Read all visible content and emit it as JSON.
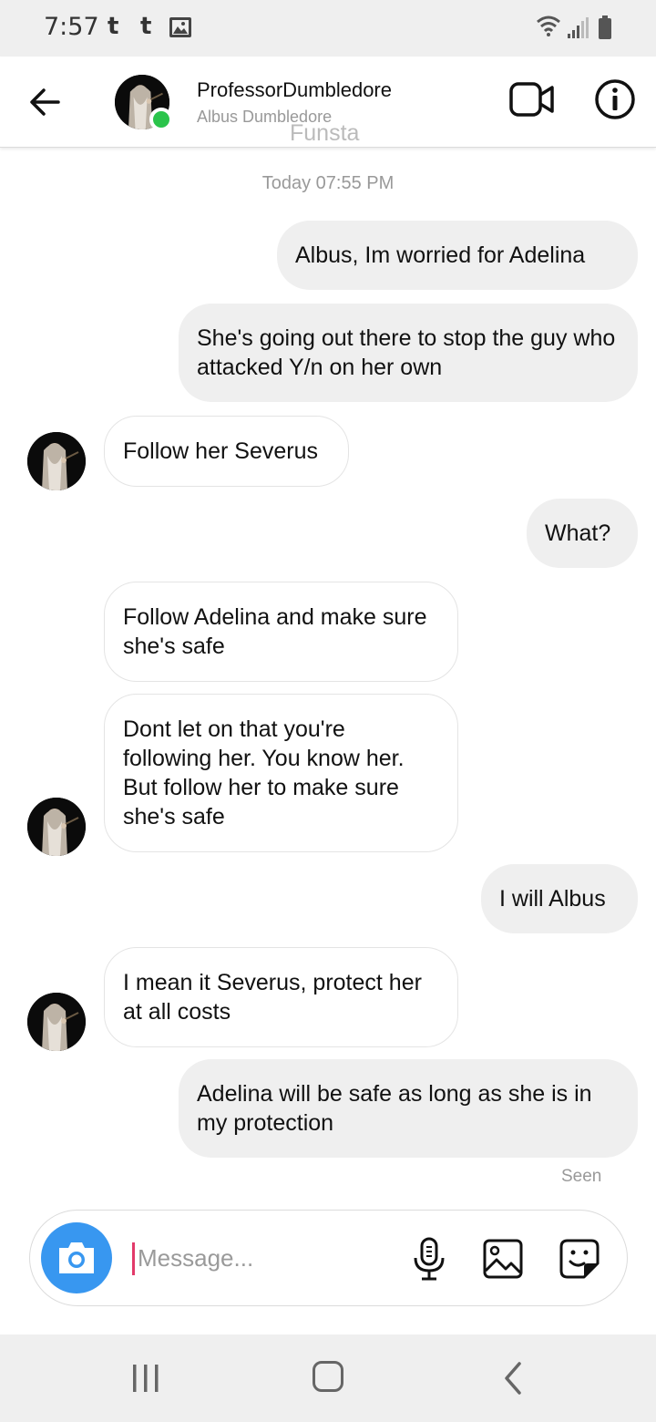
{
  "status_bar": {
    "time": "7:57",
    "notif_1": "t",
    "notif_2": "t",
    "image_icon": "gallery-notification-icon",
    "wifi_icon": "wifi-icon",
    "signal_icon": "cellular-signal-icon",
    "battery_icon": "battery-icon"
  },
  "header": {
    "back_icon": "arrow-left-icon",
    "username": "ProfessorDumbledore",
    "display_name": "Albus Dumbledore",
    "watermark": "Funsta",
    "video_icon": "video-call-icon",
    "info_icon": "info-icon",
    "online_color": "#2bc44b"
  },
  "conversation": {
    "timestamp": "Today 07:55 PM",
    "messages": [
      {
        "direction": "outgoing",
        "text": "Albus, Im worried for Adelina"
      },
      {
        "direction": "outgoing",
        "text": "She's going out there to stop the guy who attacked Y/n on her own"
      },
      {
        "direction": "incoming",
        "text": "Follow her Severus"
      },
      {
        "direction": "outgoing",
        "text": "What?"
      },
      {
        "direction": "incoming",
        "text": "Follow Adelina and make sure she's safe"
      },
      {
        "direction": "incoming",
        "text": "Dont let on that you're following her. You know her. But follow her to make sure she's safe"
      },
      {
        "direction": "outgoing",
        "text": "I will Albus"
      },
      {
        "direction": "incoming",
        "text": "I mean it Severus, protect her at all costs"
      },
      {
        "direction": "outgoing",
        "text": "Adelina will be safe as long as she is in my protection"
      }
    ],
    "seen_label": "Seen"
  },
  "composer": {
    "camera_icon": "camera-icon",
    "placeholder": "Message...",
    "value": "",
    "mic_icon": "microphone-icon",
    "gallery_icon": "image-icon",
    "sticker_icon": "sticker-icon",
    "camera_color": "#3897f0"
  },
  "nav_bar": {
    "recent_icon": "recent-apps-icon",
    "home_icon": "home-icon",
    "back_icon": "back-chevron-icon"
  }
}
